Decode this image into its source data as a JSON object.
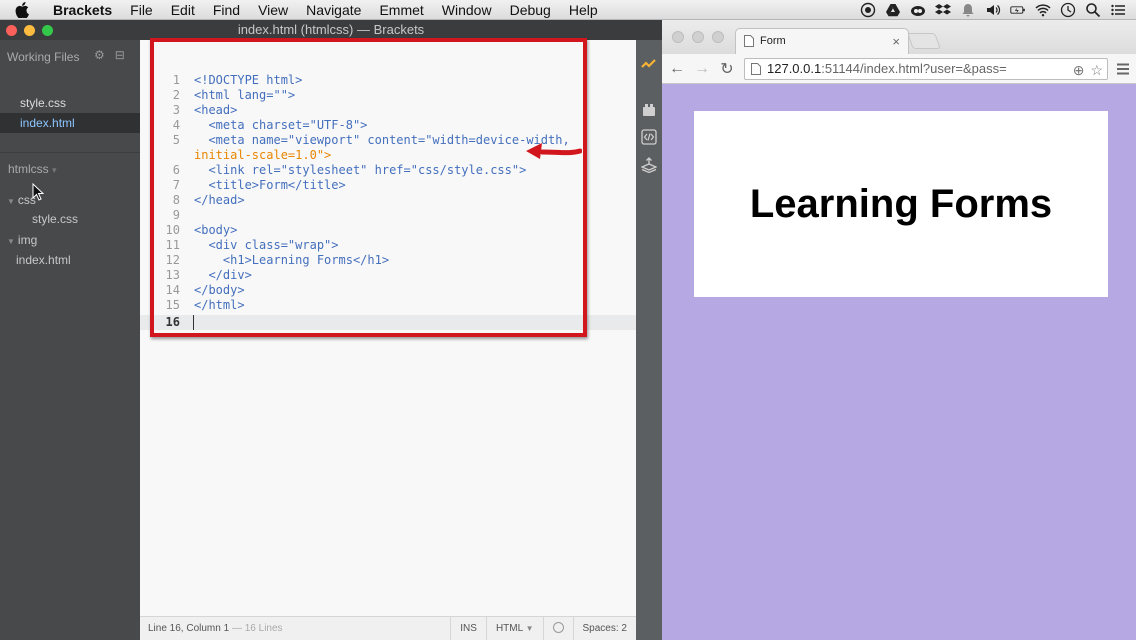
{
  "menubar": {
    "app": "Brackets",
    "items": [
      "File",
      "Edit",
      "Find",
      "View",
      "Navigate",
      "Emmet",
      "Window",
      "Debug",
      "Help"
    ]
  },
  "brackets": {
    "title": "index.html (htmlcss) — Brackets",
    "working_files_label": "Working Files",
    "working_files": [
      "style.css",
      "index.html"
    ],
    "active_file": "index.html",
    "project_label": "htmlcss",
    "tree": [
      {
        "label": "css",
        "type": "folder"
      },
      {
        "label": "style.css",
        "type": "file"
      },
      {
        "label": "img",
        "type": "folder"
      },
      {
        "label": "index.html",
        "type": "file"
      }
    ],
    "code_lines": [
      {
        "n": "1",
        "text": "<!DOCTYPE html>"
      },
      {
        "n": "2",
        "text": "<html lang=\"\">"
      },
      {
        "n": "3",
        "text": "<head>"
      },
      {
        "n": "4",
        "text": "  <meta charset=\"UTF-8\">"
      },
      {
        "n": "5",
        "text": "  <meta name=\"viewport\" content=\"width=device-width,"
      },
      {
        "n": "",
        "text": "initial-scale=1.0\">"
      },
      {
        "n": "6",
        "text": "  <link rel=\"stylesheet\" href=\"css/style.css\">"
      },
      {
        "n": "7",
        "text": "  <title>Form</title>"
      },
      {
        "n": "8",
        "text": "</head>"
      },
      {
        "n": "9",
        "text": ""
      },
      {
        "n": "10",
        "text": "<body>"
      },
      {
        "n": "11",
        "text": "  <div class=\"wrap\">"
      },
      {
        "n": "12",
        "text": "    <h1>Learning Forms</h1>"
      },
      {
        "n": "13",
        "text": "  </div>"
      },
      {
        "n": "14",
        "text": "</body>"
      },
      {
        "n": "15",
        "text": "</html>"
      },
      {
        "n": "16",
        "text": ""
      }
    ],
    "status": {
      "position": "Line 16, Column 1",
      "lines": "— 16 Lines",
      "mode": "INS",
      "language": "HTML",
      "spaces": "Spaces: 2"
    }
  },
  "chrome": {
    "tab_title": "Form",
    "url_host": "127.0.0.1",
    "url_rest": ":51144/index.html?user=&pass=",
    "page_heading": "Learning Forms"
  },
  "colors": {
    "page_background": "#b6a8e3",
    "highlight": "#d2161e",
    "active_file": "#8fc6ff"
  }
}
